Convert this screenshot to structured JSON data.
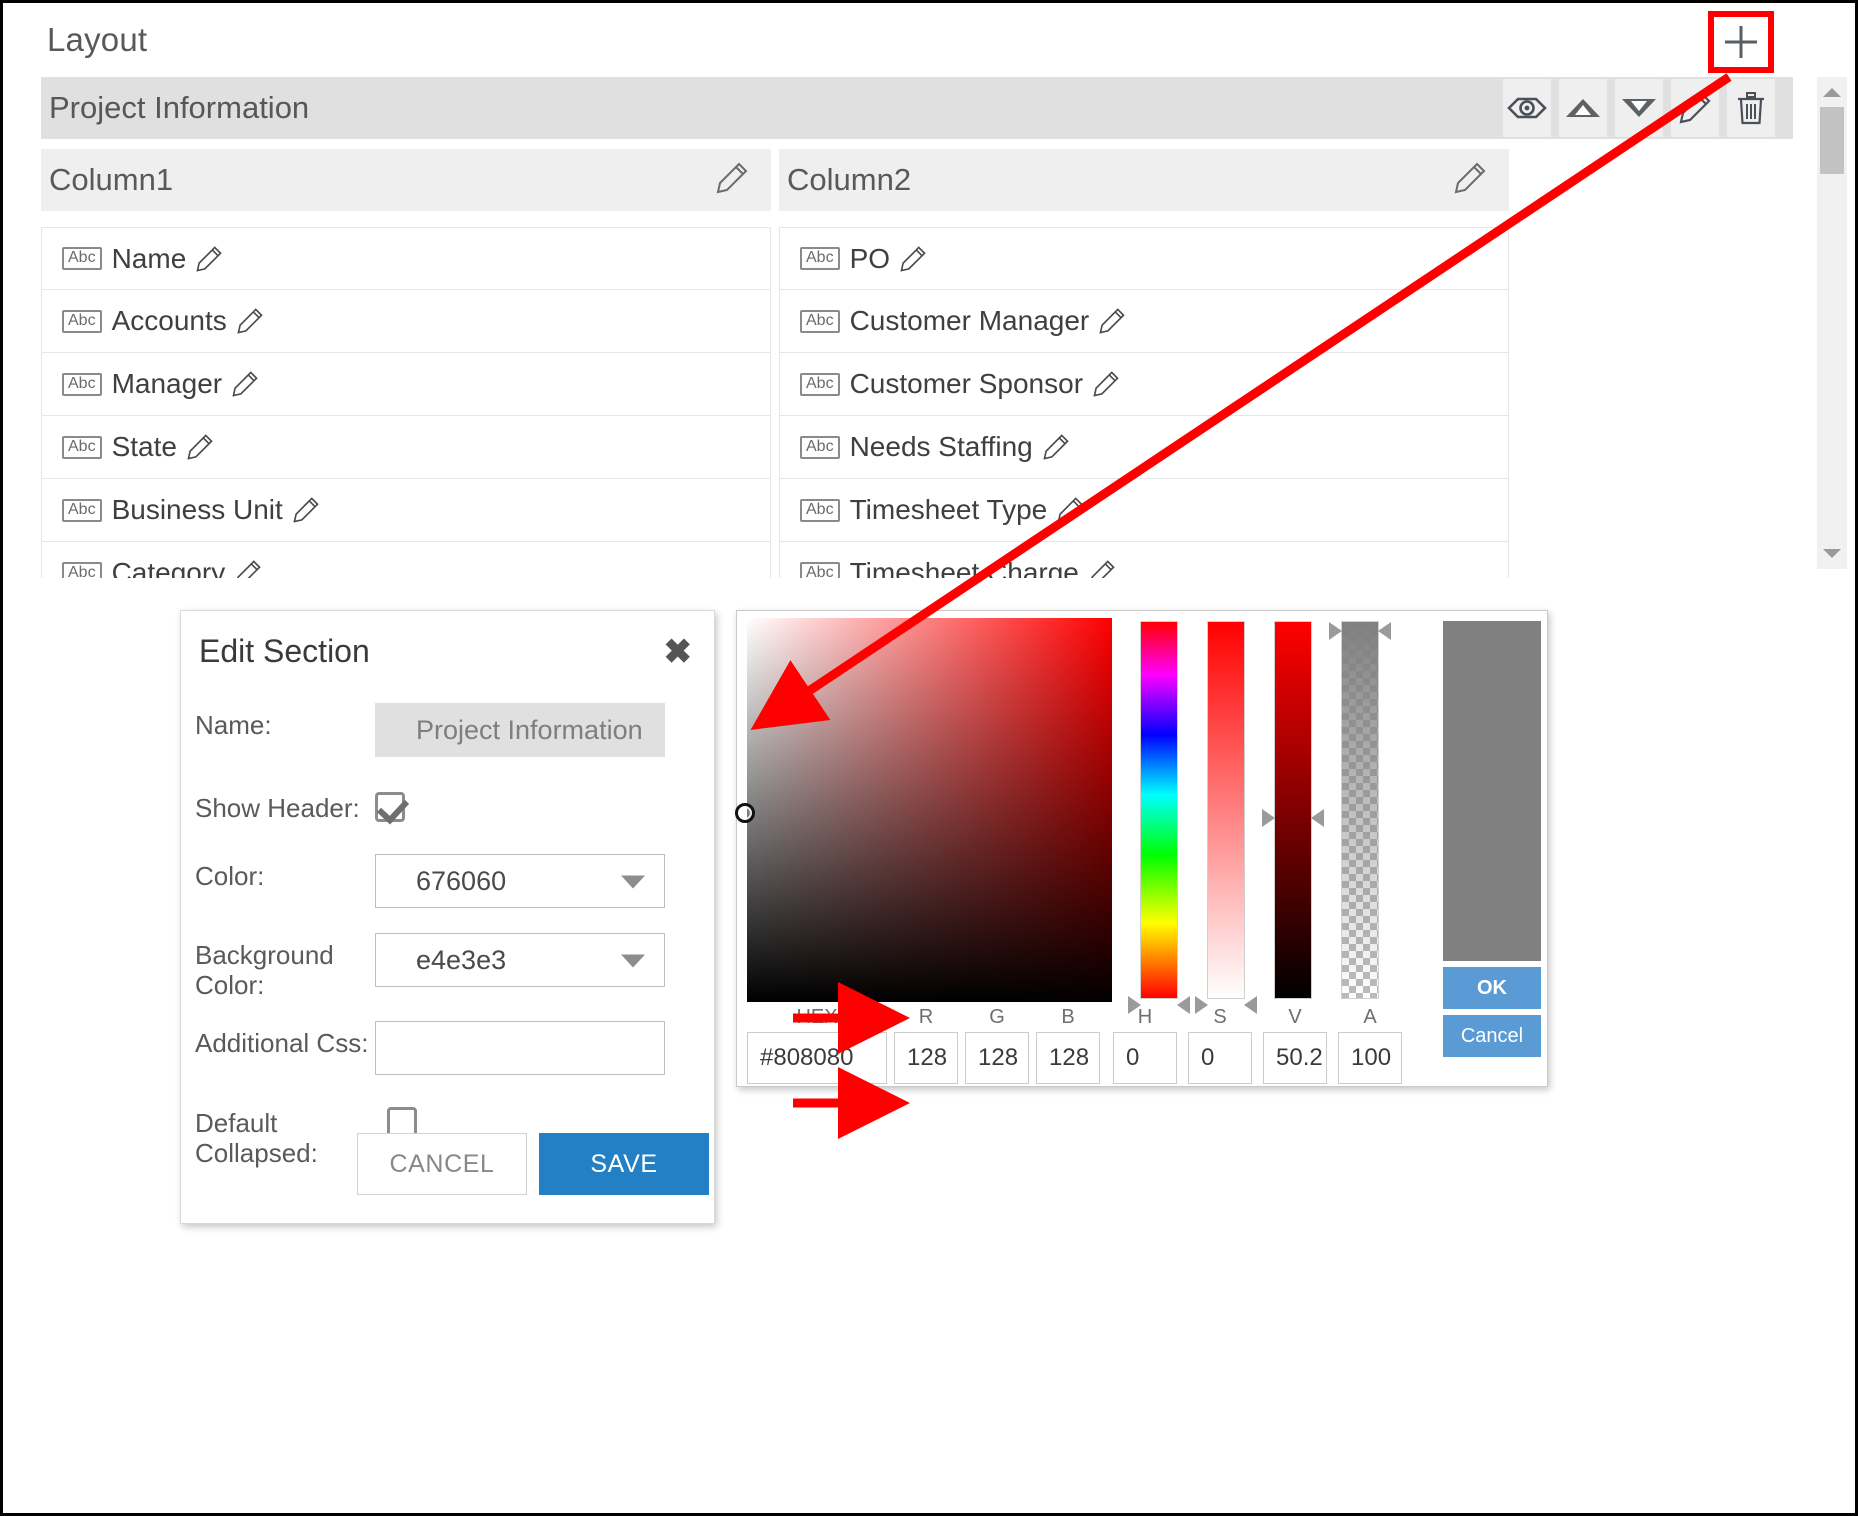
{
  "page": {
    "title": "Layout"
  },
  "section": {
    "name": "Project Information",
    "tools": [
      {
        "name": "preview-icon",
        "label": "Preview"
      },
      {
        "name": "move-up-icon",
        "label": "Move Up"
      },
      {
        "name": "move-down-icon",
        "label": "Move Down"
      },
      {
        "name": "edit-icon",
        "label": "Edit"
      },
      {
        "name": "delete-icon",
        "label": "Delete"
      }
    ]
  },
  "columns": [
    {
      "name": "Column1",
      "fields": [
        {
          "type": "Abc",
          "label": "Name"
        },
        {
          "type": "Abc",
          "label": "Accounts"
        },
        {
          "type": "Abc",
          "label": "Manager"
        },
        {
          "type": "Abc",
          "label": "State"
        },
        {
          "type": "Abc",
          "label": "Business Unit"
        },
        {
          "type": "Abc",
          "label": "Category"
        }
      ]
    },
    {
      "name": "Column2",
      "fields": [
        {
          "type": "Abc",
          "label": "PO"
        },
        {
          "type": "Abc",
          "label": "Customer Manager"
        },
        {
          "type": "Abc",
          "label": "Customer Sponsor"
        },
        {
          "type": "Abc",
          "label": "Needs Staffing"
        },
        {
          "type": "Abc",
          "label": "Timesheet Type"
        },
        {
          "type": "Abc",
          "label": "Timesheet Charge"
        }
      ]
    }
  ],
  "edit_dialog": {
    "title": "Edit Section",
    "close_label": "✖",
    "fields": {
      "name_label": "Name:",
      "name_value": "Project Information",
      "show_header_label": "Show Header:",
      "show_header_checked": true,
      "color_label": "Color:",
      "color_value": "676060",
      "background_color_label": "Background Color:",
      "background_color_value": "e4e3e3",
      "additional_css_label": "Additional Css:",
      "additional_css_value": "",
      "default_collapsed_label": "Default Collapsed:",
      "default_collapsed_checked": false
    },
    "cancel_label": "CANCEL",
    "save_label": "SAVE",
    "save_color": "#2480c4"
  },
  "color_picker": {
    "ok_label": "OK",
    "cancel_label": "Cancel",
    "preview_color": "#808080",
    "fields": [
      {
        "label": "HEX",
        "value": "#808080",
        "width": "hex"
      },
      {
        "label": "R",
        "value": "128",
        "width": "num"
      },
      {
        "label": "G",
        "value": "128",
        "width": "num"
      },
      {
        "label": "B",
        "value": "128",
        "width": "num"
      },
      {
        "label": "H",
        "value": "0",
        "width": "num"
      },
      {
        "label": "S",
        "value": "0",
        "width": "num"
      },
      {
        "label": "V",
        "value": "50.2",
        "width": "num"
      },
      {
        "label": "A",
        "value": "100",
        "width": "num"
      }
    ],
    "sliders": [
      {
        "name": "hue-slider"
      },
      {
        "name": "saturation-slider"
      },
      {
        "name": "value-slider"
      },
      {
        "name": "alpha-slider"
      }
    ]
  },
  "annotation": {
    "add_section_label": "+",
    "highlight_color": "#fe0000"
  }
}
